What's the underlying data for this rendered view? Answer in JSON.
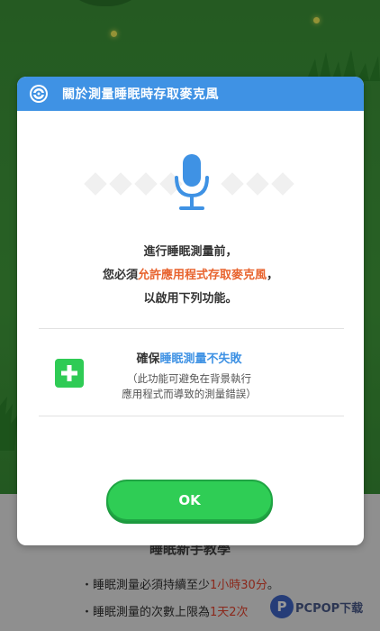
{
  "dialog": {
    "title": "關於測量睡眠時存取麥克風",
    "intro_line1": "進行睡眠測量前，",
    "intro_line2_pre": "您必須",
    "intro_line2_highlight": "允許應用程式存取麥克風",
    "intro_line2_post": "，",
    "intro_line3": "以啟用下列功能。",
    "feature": {
      "title_pre": "確保",
      "title_highlight": "睡眠測量不失敗",
      "desc_line1": "（此功能可避免在背景執行",
      "desc_line2": "應用程式而導致的測量錯誤）"
    },
    "ok_label": "OK"
  },
  "background": {
    "tutorial_title": "睡眠新手教學",
    "tip1_pre": "・睡眠測量必須持續至少",
    "tip1_highlight": "1小時30分",
    "tip1_post": "。",
    "tip2_pre": "・睡眠測量的次數上限為",
    "tip2_highlight": "1天2次",
    "watermark": "PCPOP下载"
  },
  "colors": {
    "header_blue": "#3f92e4",
    "ok_green": "#2fcd55",
    "highlight_orange": "#e8632e",
    "highlight_blue": "#3f92e4"
  },
  "icons": {
    "header": "pokeball-icon",
    "main": "microphone-icon",
    "feature": "plus-icon"
  }
}
